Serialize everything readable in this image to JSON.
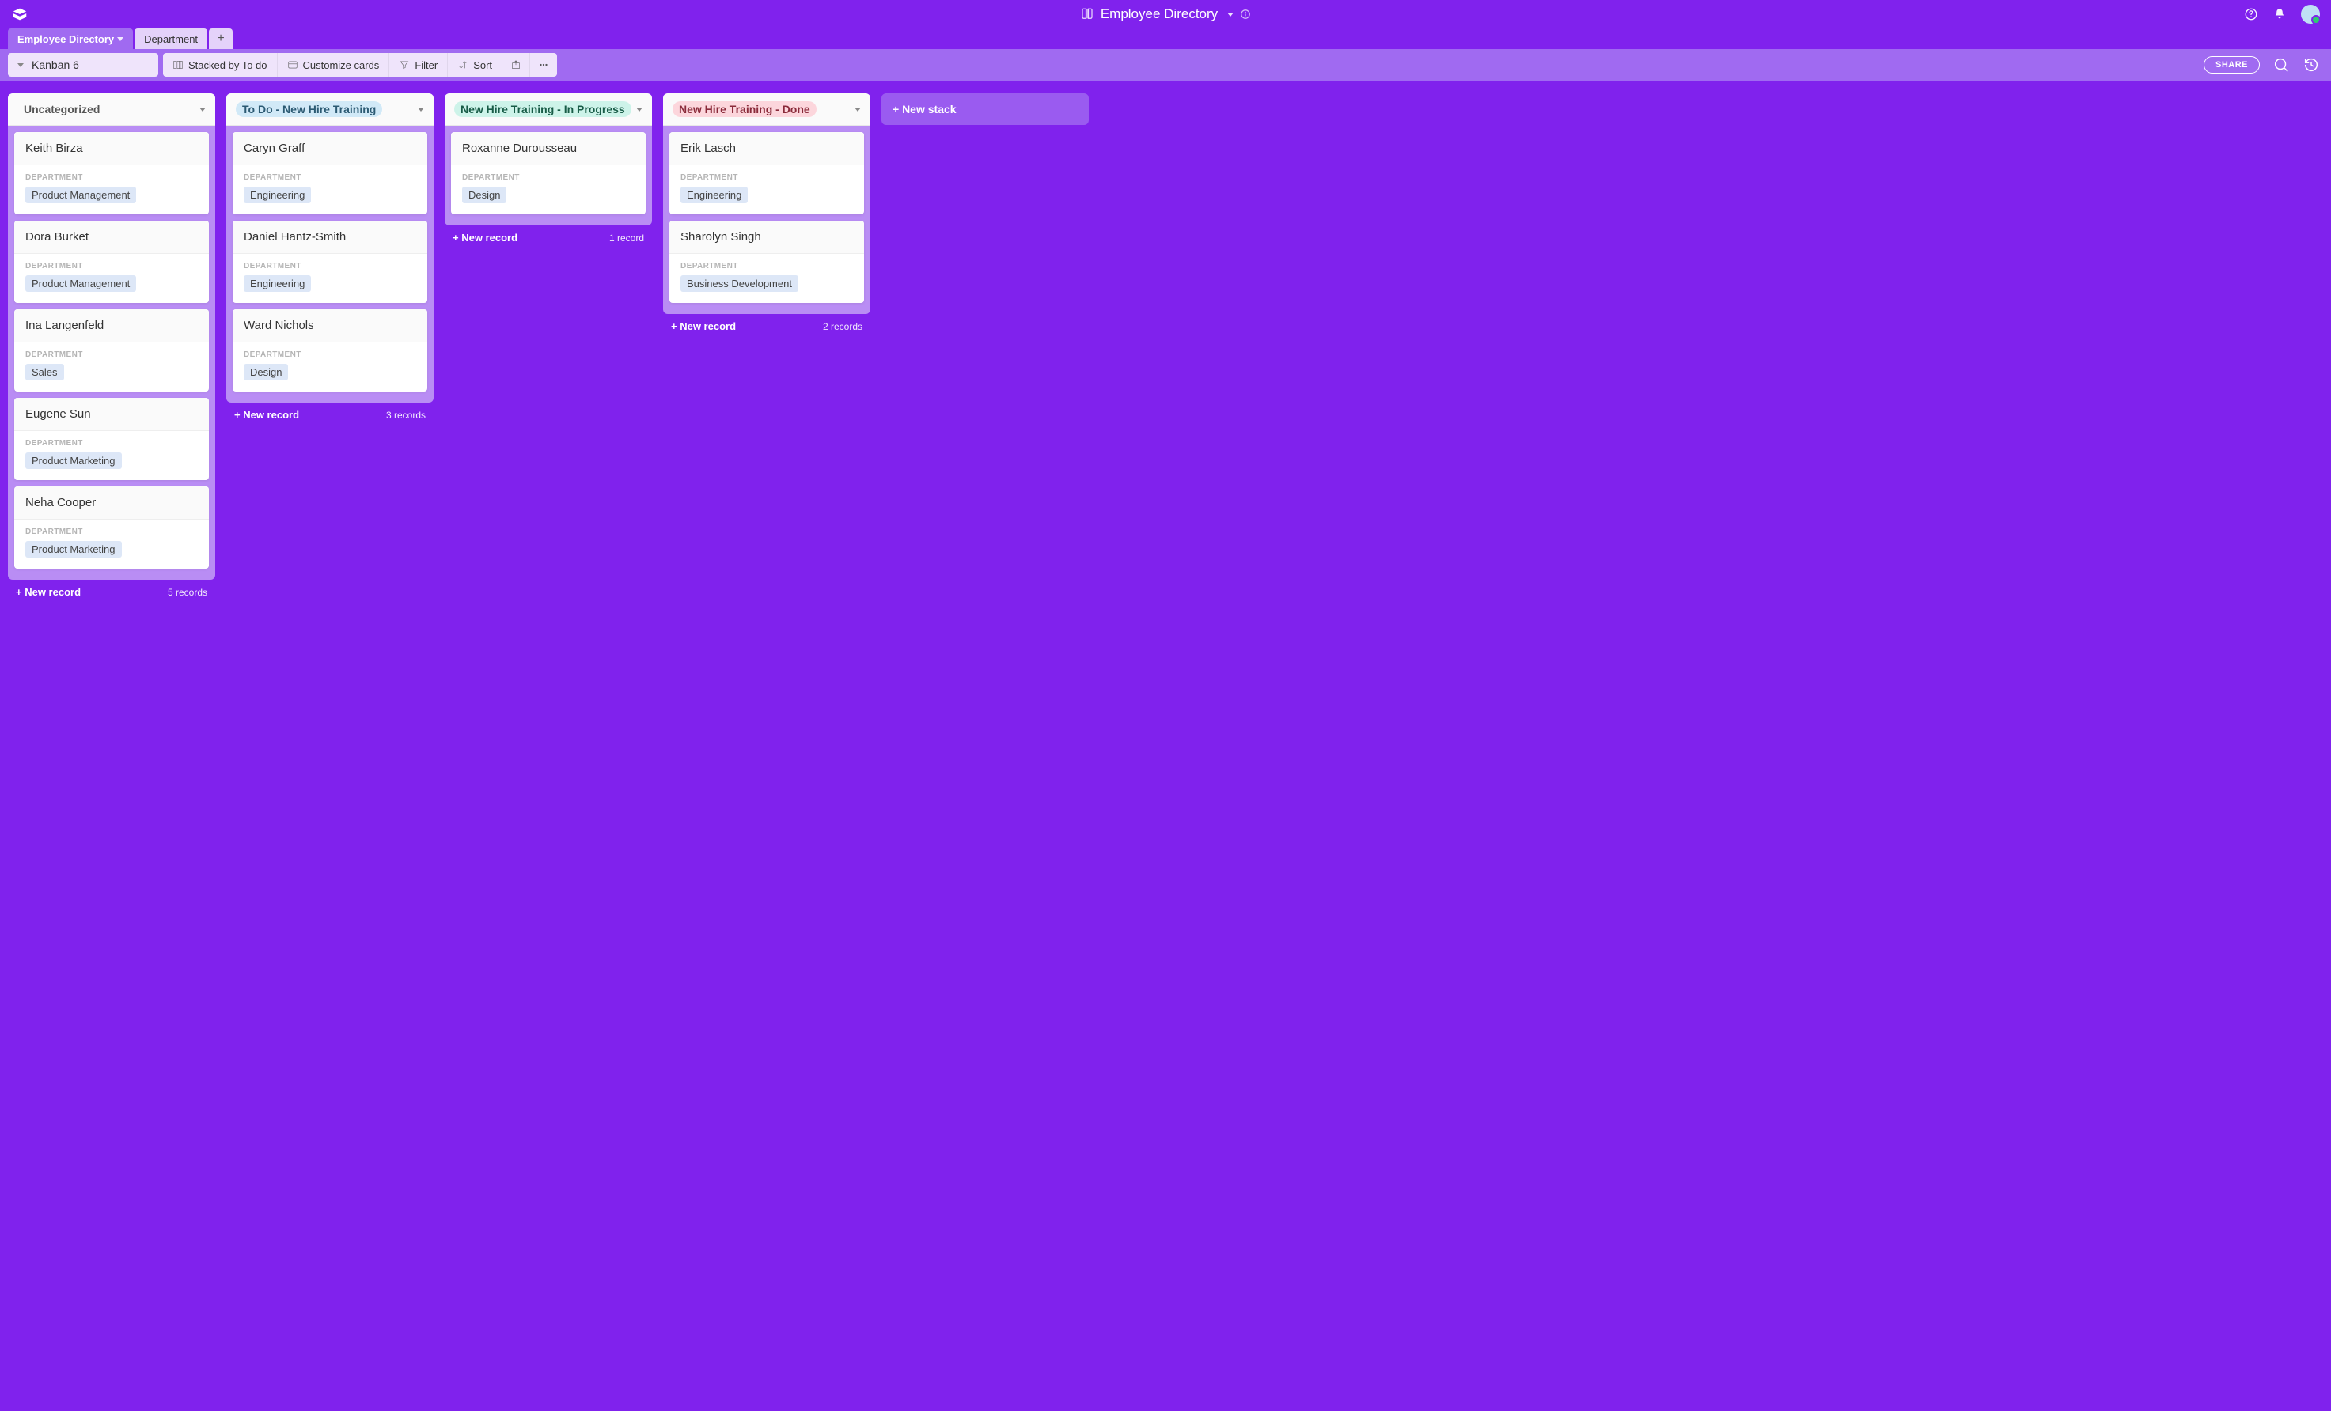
{
  "header": {
    "title": "Employee Directory"
  },
  "tabs": {
    "active": "Employee Directory",
    "inactive": "Department"
  },
  "toolbar": {
    "view": "Kanban 6",
    "stacked": "Stacked by To do",
    "customize": "Customize cards",
    "filter": "Filter",
    "sort": "Sort",
    "share": "SHARE"
  },
  "board": {
    "field_label": "DEPARTMENT",
    "new_record": "+ New record",
    "new_stack": "+ New stack",
    "stacks": [
      {
        "title": "Uncategorized",
        "titleClass": "",
        "count": "5 records",
        "cards": [
          {
            "name": "Keith Birza",
            "dept": "Product Management"
          },
          {
            "name": "Dora Burket",
            "dept": "Product Management"
          },
          {
            "name": "Ina Langenfeld",
            "dept": "Sales"
          },
          {
            "name": "Eugene Sun",
            "dept": "Product Marketing"
          },
          {
            "name": "Neha Cooper",
            "dept": "Product Marketing"
          }
        ]
      },
      {
        "title": "To Do - New Hire Training",
        "titleClass": "c-blue",
        "count": "3 records",
        "cards": [
          {
            "name": "Caryn Graff",
            "dept": "Engineering"
          },
          {
            "name": "Daniel Hantz-Smith",
            "dept": "Engineering"
          },
          {
            "name": "Ward Nichols",
            "dept": "Design"
          }
        ]
      },
      {
        "title": "New Hire Training - In Progress",
        "titleClass": "c-teal",
        "count": "1 record",
        "cards": [
          {
            "name": "Roxanne Durousseau",
            "dept": "Design"
          }
        ]
      },
      {
        "title": "New Hire Training - Done",
        "titleClass": "c-pink",
        "count": "2 records",
        "cards": [
          {
            "name": "Erik Lasch",
            "dept": "Engineering"
          },
          {
            "name": "Sharolyn Singh",
            "dept": "Business Development"
          }
        ]
      }
    ]
  }
}
